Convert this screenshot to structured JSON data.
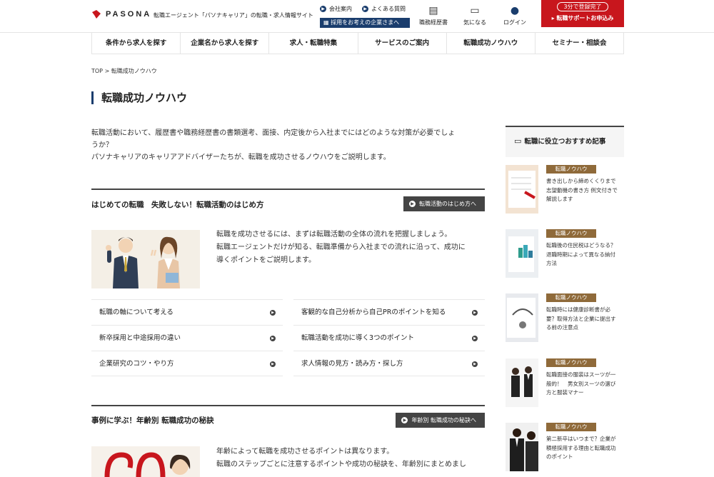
{
  "header": {
    "logo": "PASONA",
    "tagline": "転職エージェント「パソナキャリア」の転職・求人情報サイト",
    "company_link": "会社案内",
    "faq_link": "よくある質問",
    "recruit_button": "採用をお考えの企業さまへ",
    "resume_label": "職務経歴書",
    "favorites_label": "気になる",
    "login_label": "ログイン",
    "cta_top": "3分で登録完了",
    "cta_main": "転職サポートお申込み"
  },
  "nav": [
    "条件から求人を探す",
    "企業名から求人を探す",
    "求人・転職特集",
    "サービスのご案内",
    "転職成功ノウハウ",
    "セミナー・相談会"
  ],
  "breadcrumb": {
    "home": "TOP",
    "sep": ">",
    "current": "転職成功ノウハウ"
  },
  "page_title": "転職成功ノウハウ",
  "intro": {
    "line1": "転職活動において、履歴書や職務経歴書の書類選考、面接、内定後から入社までにはどのような対策が必要でしょ",
    "line2": "うか？",
    "line3": "パソナキャリアのキャリアアドバイザーたちが、転職を成功させるノウハウをご説明します。"
  },
  "section1": {
    "title": "はじめての転職　失敗しない！転職活動のはじめ方",
    "button": "転職活動のはじめ方へ",
    "desc1": "転職を成功させるには、まずは転職活動の全体の流れを把握しましょう。",
    "desc2": "転職エージェントだけが知る、転職準備から入社までの流れに沿って、成功に",
    "desc3": "導くポイントをご説明します。",
    "links": [
      "転職の軸について考える",
      "客観的な自己分析から自己PRのポイントを知る",
      "新卒採用と中途採用の違い",
      "転職活動を成功に導く3つのポイント",
      "企業研究のコツ・やり方",
      "求人情報の見方・読み方・探し方"
    ]
  },
  "section2": {
    "title": "事例に学ぶ！年齢別 転職成功の秘訣",
    "button": "年齢別 転職成功の秘訣へ",
    "desc1": "年齢によって転職を成功させるポイントは異なります。",
    "desc2": "転職のステップごとに注意するポイントや成功の秘訣を、年齢別にまとめまし"
  },
  "sidebar": {
    "heading": "転職に役立つおすすめ記事",
    "articles": [
      {
        "badge": "転職ノウハウ",
        "l1": "書き出しから締めくくりまで",
        "l2": "志望動機の書き方 例文付きで",
        "l3": "解説します"
      },
      {
        "badge": "転職ノウハウ",
        "l1": "転職後の住民税はどうなる？",
        "l2": "退職時期によって異なる納付",
        "l3": "方法"
      },
      {
        "badge": "転職ノウハウ",
        "l1": "転職時には健康診断書が必",
        "l2": "要？取得方法と企業に提出す",
        "l3": "る前の注意点"
      },
      {
        "badge": "転職ノウハウ",
        "l1": "転職面接の服装はスーツが一",
        "l2": "般的！　男女別スーツの選び",
        "l3": "方と服装マナー"
      },
      {
        "badge": "転職ノウハウ",
        "l1": "第二新卒はいつまで？企業が",
        "l2": "積極採用する理由と転職成功",
        "l3": "のポイント"
      }
    ]
  },
  "colors": {
    "brand_red": "#c8161d",
    "navy": "#1a3d6d",
    "badge_brown": "#8f6a3a"
  }
}
